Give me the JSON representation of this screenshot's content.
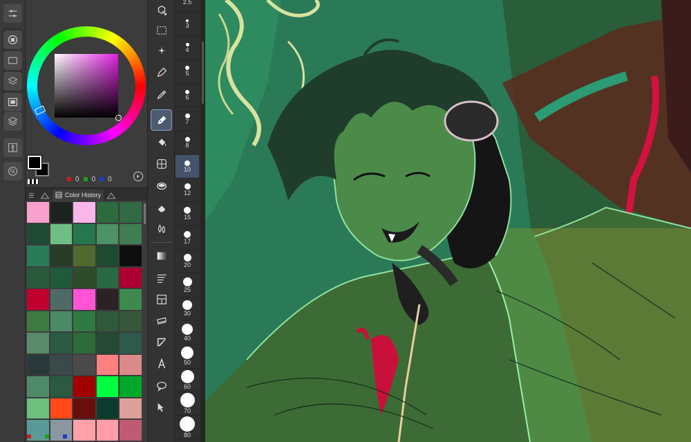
{
  "color_panel": {
    "rgb": [
      {
        "channel": "red",
        "value": "0",
        "color": "#c81e1e"
      },
      {
        "channel": "green",
        "value": "0",
        "color": "#1ea01e"
      },
      {
        "channel": "blue",
        "value": "0",
        "color": "#1e3cc8"
      }
    ],
    "foreground_color": "#000000",
    "background_color": "#000000"
  },
  "history_panel": {
    "tab_label": "Color History",
    "swatches": [
      "#f7a1cf",
      "#1c221f",
      "#f8b6ea",
      "#2d6a3d",
      "#2f6a45",
      "#1f4a35",
      "#6fbf82",
      "#25774d",
      "#4d9166",
      "#3e7e52",
      "#2a7a5a",
      "#253d25",
      "#4f6a2e",
      "#1e4a30",
      "#0d0d0d",
      "#2a5a3c",
      "#1f5a3a",
      "#2d4d2a",
      "#2a6a42",
      "#ab0030",
      "#c20030",
      "#4e6a66",
      "#ff55d5",
      "#2a2224",
      "#3e8a4e",
      "#3e7a42",
      "#4a8a66",
      "#2f7a42",
      "#2e5a3a",
      "#36583a",
      "#5a8a6a",
      "#2a5a44",
      "#2e6a3a",
      "#244a34",
      "#2e5a4e",
      "#2a3a3a",
      "#3a4a4a",
      "#4a4a4a",
      "#ff8080",
      "#db8a8a",
      "#4e8a6a",
      "#2a5a42",
      "#a00000",
      "#00ff40",
      "#00a82a",
      "#6ebe7e",
      "#ff4a1a",
      "#6a0d0d",
      "#0d3a2e",
      "#dca098",
      "#5a9a96",
      "#8a96a0",
      "#ffa0a8",
      "#ff9ea8",
      "#c05a72"
    ]
  },
  "sizes": [
    "2.5",
    "3",
    "4",
    "5",
    "6",
    "7",
    "8",
    "10",
    "12",
    "15",
    "17",
    "20",
    "25",
    "30",
    "40",
    "50",
    "60",
    "70",
    "80"
  ],
  "selected_size": "10",
  "tools": [
    {
      "name": "operation-tool",
      "icon": "cube-arrow-icon"
    },
    {
      "name": "selection-tool",
      "icon": "dashed-rect-icon"
    },
    {
      "name": "auto-select-tool",
      "icon": "magic-wand-icon"
    },
    {
      "name": "pen-tool",
      "icon": "pen-nib-icon"
    },
    {
      "name": "eyedropper-tool",
      "icon": "eyedropper-icon"
    },
    {
      "name": "pen-active-tool",
      "icon": "fountain-pen-icon"
    },
    {
      "name": "fill-tool",
      "icon": "bucket-icon"
    },
    {
      "name": "perspective-tool",
      "icon": "grid-sphere-icon"
    },
    {
      "name": "decoration-tool",
      "icon": "tape-icon"
    },
    {
      "name": "eraser-tool",
      "icon": "eraser-icon"
    },
    {
      "name": "blend-tool",
      "icon": "drops-icon"
    },
    {
      "name": "gradient-tool",
      "icon": "gradient-icon"
    },
    {
      "name": "figure-tool",
      "icon": "lines-icon"
    },
    {
      "name": "frame-tool",
      "icon": "frame-icon"
    },
    {
      "name": "ruler-tool",
      "icon": "ruler-icon"
    },
    {
      "name": "correct-line-tool",
      "icon": "triangle-icon"
    },
    {
      "name": "text-tool",
      "icon": "letter-a-icon"
    },
    {
      "name": "balloon-tool",
      "icon": "speech-bubble-icon"
    },
    {
      "name": "move-tool",
      "icon": "cursor-arrow-icon"
    }
  ],
  "colors": {
    "panel_bg": "#3c3c3c",
    "toolbar_bg": "#333333",
    "active_highlight": "#4c5b70",
    "canvas_green": "#2c7a58"
  }
}
